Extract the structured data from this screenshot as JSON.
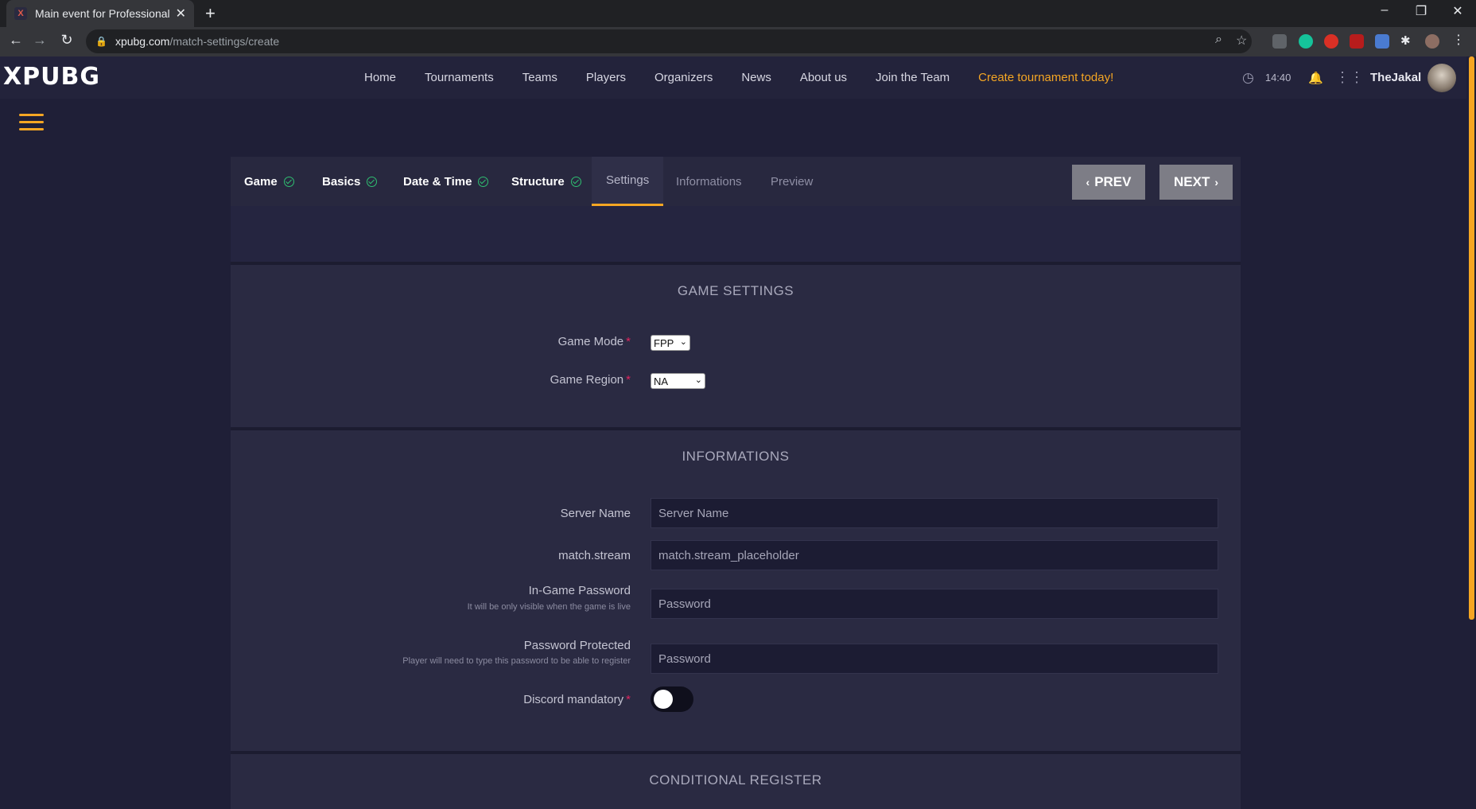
{
  "browser": {
    "tab_title": "Main event for Professional Gam",
    "tab_favicon": "X",
    "url_host": "xpubg.com",
    "url_path": "/match-settings/create"
  },
  "header": {
    "logo": "XPUBG",
    "nav": [
      "Home",
      "Tournaments",
      "Teams",
      "Players",
      "Organizers",
      "News",
      "About us",
      "Join the Team"
    ],
    "cta": "Create tournament today!",
    "time": "14:40",
    "username": "TheJakal",
    "accent": "#f5a623"
  },
  "wizard": {
    "steps": [
      {
        "label": "Game",
        "state": "done"
      },
      {
        "label": "Basics",
        "state": "done"
      },
      {
        "label": "Date & Time",
        "state": "done"
      },
      {
        "label": "Structure",
        "state": "done"
      },
      {
        "label": "Settings",
        "state": "active"
      },
      {
        "label": "Informations",
        "state": "todo"
      },
      {
        "label": "Preview",
        "state": "todo"
      }
    ],
    "prev_label": "PREV",
    "next_label": "NEXT"
  },
  "game_settings": {
    "title": "GAME SETTINGS",
    "game_mode_label": "Game Mode",
    "game_mode_value": "FPP",
    "game_region_label": "Game Region",
    "game_region_value": "NA"
  },
  "informations": {
    "title": "INFORMATIONS",
    "server_name_label": "Server Name",
    "server_name_placeholder": "Server Name",
    "stream_label": "match.stream",
    "stream_placeholder": "match.stream_placeholder",
    "ingame_password_label": "In-Game Password",
    "ingame_password_hint": "It will be only visible when the game is live",
    "ingame_password_placeholder": "Password",
    "protected_label": "Password Protected",
    "protected_hint": "Player will need to type this password to be able to register",
    "protected_placeholder": "Password",
    "discord_label": "Discord mandatory",
    "discord_on": false
  },
  "conditional": {
    "title": "CONDITIONAL REGISTER"
  }
}
